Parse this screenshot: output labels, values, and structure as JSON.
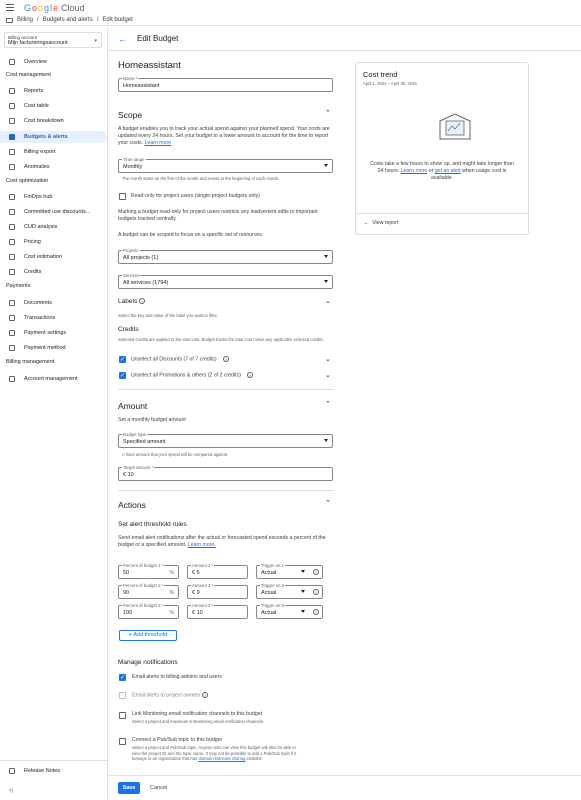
{
  "app": {
    "title": "Google Cloud"
  },
  "breadcrumb": [
    "Billing",
    "/",
    "Budgets and alerts",
    "/",
    "Edit budget"
  ],
  "account": {
    "label": "Billing account",
    "name": "Mijn factureringsaccount"
  },
  "sidebar": {
    "overview": "Overview",
    "sections": {
      "cost_management": "Cost management",
      "cost_optimization": "Cost optimization",
      "payments": "Payments",
      "billing_management": "Billing management"
    },
    "cost_management_items": [
      "Reports",
      "Cost table",
      "Cost breakdown",
      "Budgets & alerts",
      "Billing export",
      "Anomalies"
    ],
    "cost_optimization_items": [
      "FinOps hub",
      "Committed use discounts...",
      "CUD analysis",
      "Pricing",
      "Cost estimation",
      "Credits"
    ],
    "payments_items": [
      "Documents",
      "Transactions",
      "Payment settings",
      "Payment method"
    ],
    "billing_management_items": [
      "Account management"
    ],
    "release_notes": "Release Notes",
    "collapse": "<|"
  },
  "page": {
    "title": "Edit Budget"
  },
  "budget": {
    "heading": "Homeassistant",
    "name_label": "Name *",
    "name_value": "Homeassistant"
  },
  "scope": {
    "title": "Scope",
    "desc": "A budget enables you to track your actual spend against your planned spend. Your costs are updated every 24 hours. Set your budget to a lower amount to account for the time to report your costs.",
    "learn_more": "Learn more",
    "time_range_label": "Time range",
    "time_range_value": "Monthly",
    "time_range_hint": "The month starts on the first of the month and resets at the beginning of each month.",
    "readonly_label": "Read-only for project users (single-project budgets only)",
    "readonly_desc": "Marking a budget read-only for project users restricts any inadvertent edits to important budgets tracked centrally.",
    "scope_desc": "A budget can be scoped to focus on a specific set of resources.",
    "projects_label": "Projects",
    "projects_value": "All projects (1)",
    "services_label": "Services",
    "services_value": "All services (1794)",
    "labels_title": "Labels",
    "labels_desc": "Select the key and value of the label you want to filter.",
    "credits_title": "Credits",
    "credits_desc": "Selected credits are applied to the total cost. Budget tracks the total cost minus any applicable selected credits.",
    "discounts_label": "Unselect all Discounts (7 of 7 credits)",
    "promotions_label": "Unselect all Promotions & others (2 of 2 credits)"
  },
  "amount": {
    "title": "Amount",
    "desc": "Set a monthly budget amount",
    "type_label": "Budget type",
    "type_value": "Specified amount",
    "type_hint": "A fixed amount that your spend will be compared against.",
    "target_label": "Target amount *",
    "target_value": "€ 10"
  },
  "actions": {
    "title": "Actions",
    "threshold_title": "Set alert threshold rules",
    "threshold_desc": "Send email alert notifications after the actual or forecasted spend exceeds a percent of the budget or a specified amount.",
    "learn_more": "Learn more.",
    "thresholds": [
      {
        "pct_label": "Percent of budget 1 *",
        "pct": "50",
        "amt_label": "Amount 1 *",
        "amt": "€ 5",
        "trig_label": "Trigger on 1",
        "trig": "Actual"
      },
      {
        "pct_label": "Percent of budget 2 *",
        "pct": "90",
        "amt_label": "Amount 2 *",
        "amt": "€ 9",
        "trig_label": "Trigger on 2",
        "trig": "Actual"
      },
      {
        "pct_label": "Percent of budget 3 *",
        "pct": "100",
        "amt_label": "Amount 3 *",
        "amt": "€ 10",
        "trig_label": "Trigger on 3",
        "trig": "Actual"
      }
    ],
    "pct_suffix": "%",
    "add_threshold": "+ Add threshold",
    "notif_title": "Manage notifications",
    "email_admins": "Email alerts to billing admins and users",
    "email_owners": "Email alerts to project owners",
    "link_monitoring": "Link Monitoring email notification channels to this budget",
    "link_monitoring_desc": "Select a project and maximum 5 Monitoring email notification channels.",
    "pubsub": "Connect a Pub/Sub topic to this budget",
    "pubsub_desc1": "Select a project and Pub/Sub topic. Anyone who can view this budget will also be able to",
    "pubsub_desc2": "view the project ID and the topic name. It may not be possible to add a Pub/Sub topic if it",
    "pubsub_desc3": "belongs to an organization that has",
    "pubsub_link": "domain restricted sharing",
    "pubsub_desc4": "enabled."
  },
  "footer": {
    "save": "Save",
    "cancel": "Cancel"
  },
  "cost_trend": {
    "title": "Cost trend",
    "range": "April 1, 2024 – April 30, 2025",
    "msg1": "Costs take a few hours to show up, and might take longer than",
    "msg2a": "24 hours.",
    "learn_more": "Learn more",
    "msg2b": "or",
    "get_alert": "get an alert",
    "msg2c": "when usage cost is",
    "msg3": "available.",
    "view_report": "View report"
  }
}
